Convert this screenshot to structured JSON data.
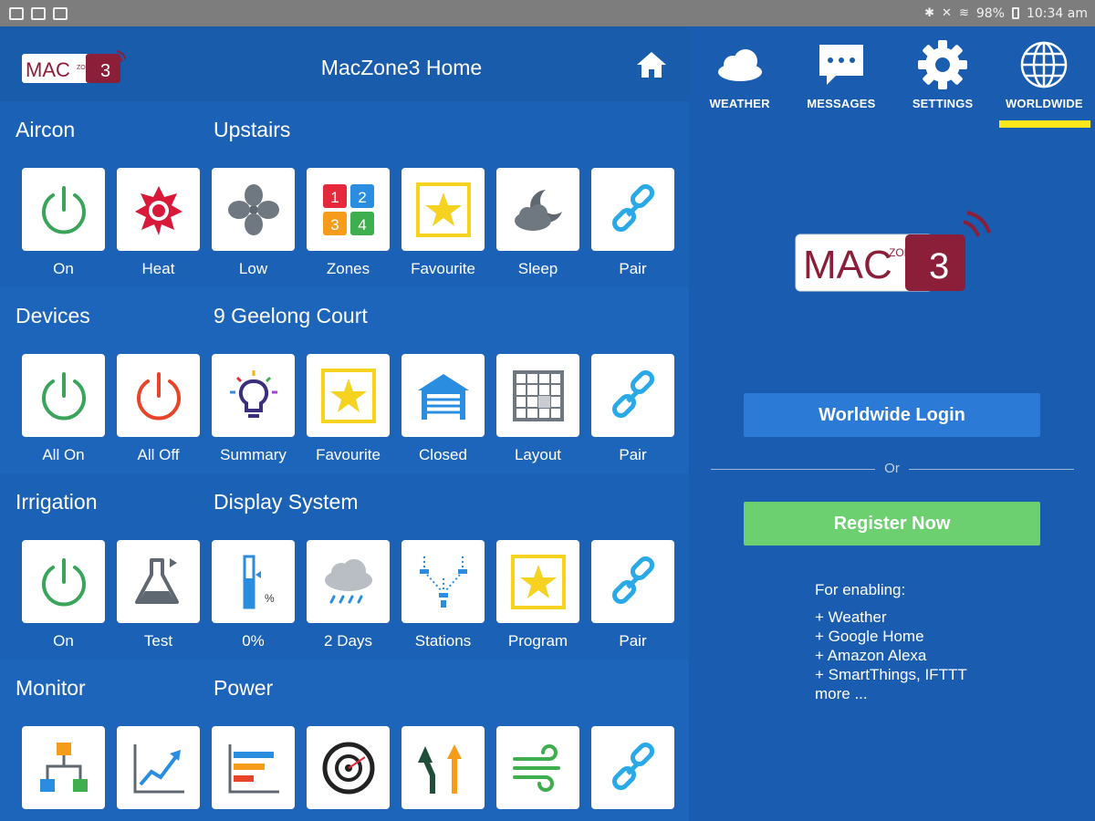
{
  "status_bar": {
    "battery": "98%",
    "time": "10:34 am"
  },
  "header": {
    "title": "MacZone3 Home",
    "logo_text": "MAC",
    "logo_zone": "ZONE",
    "logo_num": "3"
  },
  "sections": [
    {
      "left_title": "Aircon",
      "right_title": "Upstairs",
      "tiles": [
        {
          "label": "On",
          "icon": "power-green-icon"
        },
        {
          "label": "Heat",
          "icon": "sun-heat-icon"
        },
        {
          "label": "Low",
          "icon": "fan-icon"
        },
        {
          "label": "Zones",
          "icon": "zones-grid-icon"
        },
        {
          "label": "Favourite",
          "icon": "star-icon"
        },
        {
          "label": "Sleep",
          "icon": "cloud-moon-icon"
        },
        {
          "label": "Pair",
          "icon": "link-icon"
        }
      ]
    },
    {
      "left_title": "Devices",
      "right_title": "9 Geelong Court",
      "tiles": [
        {
          "label": "All On",
          "icon": "power-green-icon"
        },
        {
          "label": "All Off",
          "icon": "power-red-icon"
        },
        {
          "label": "Summary",
          "icon": "lightbulb-icon"
        },
        {
          "label": "Favourite",
          "icon": "star-icon"
        },
        {
          "label": "Closed",
          "icon": "garage-icon"
        },
        {
          "label": "Layout",
          "icon": "grid-layout-icon"
        },
        {
          "label": "Pair",
          "icon": "link-icon"
        }
      ]
    },
    {
      "left_title": "Irrigation",
      "right_title": "Display System",
      "tiles": [
        {
          "label": "On",
          "icon": "power-green-icon"
        },
        {
          "label": "Test",
          "icon": "flask-icon"
        },
        {
          "label": "0%",
          "icon": "moisture-gauge-icon"
        },
        {
          "label": "2 Days",
          "icon": "rain-cloud-icon"
        },
        {
          "label": "Stations",
          "icon": "sprinkler-icon"
        },
        {
          "label": "Program",
          "icon": "star-icon"
        },
        {
          "label": "Pair",
          "icon": "link-icon"
        }
      ]
    },
    {
      "left_title": "Monitor",
      "right_title": "Power",
      "tiles": [
        {
          "label": "",
          "icon": "network-icon"
        },
        {
          "label": "",
          "icon": "trend-chart-icon"
        },
        {
          "label": "",
          "icon": "bar-chart-icon"
        },
        {
          "label": "",
          "icon": "target-icon"
        },
        {
          "label": "",
          "icon": "split-arrow-icon"
        },
        {
          "label": "",
          "icon": "wind-icon"
        },
        {
          "label": "",
          "icon": "link-icon"
        }
      ]
    }
  ],
  "nav": [
    {
      "label": "WEATHER"
    },
    {
      "label": "MESSAGES"
    },
    {
      "label": "SETTINGS"
    },
    {
      "label": "WORLDWIDE"
    }
  ],
  "nav_selected": "WORLDWIDE",
  "worldwide": {
    "login_label": "Worldwide Login",
    "or_label": "Or",
    "register_label": "Register Now",
    "enable_head": "For enabling:",
    "enable_items": [
      "+ Weather",
      "+ Google Home",
      "+ Amazon Alexa",
      "+ SmartThings, IFTTT",
      "more ..."
    ]
  },
  "colors": {
    "background": "#1a5eb0",
    "accent_yellow": "#ffe71a",
    "register_green": "#6ccf70",
    "login_blue": "#2b7ad6",
    "logo_maroon": "#8b1f3a"
  }
}
